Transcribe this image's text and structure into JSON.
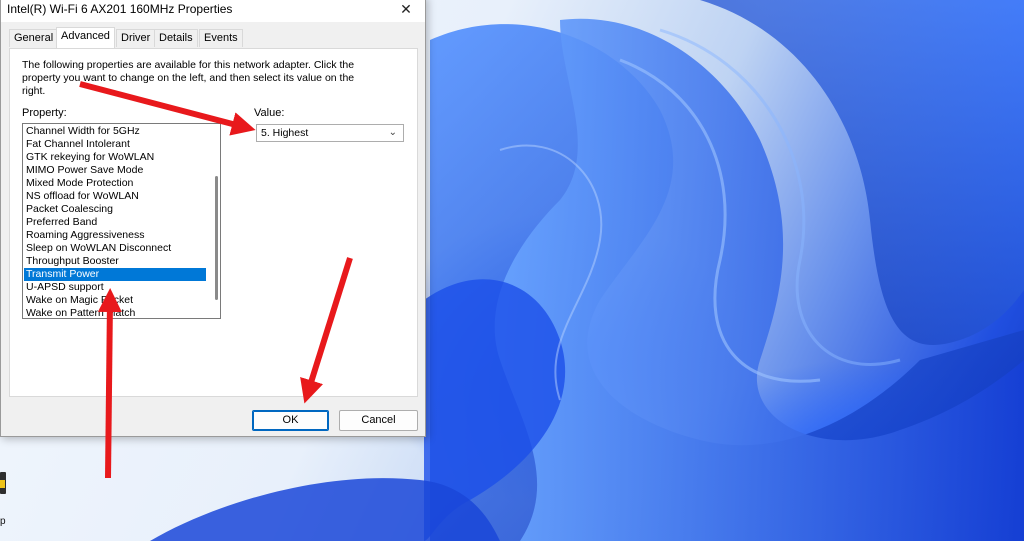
{
  "window": {
    "title": "Intel(R) Wi-Fi 6 AX201 160MHz Properties",
    "close_glyph": "✕"
  },
  "tabs": [
    {
      "label": "General"
    },
    {
      "label": "Advanced",
      "active": true
    },
    {
      "label": "Driver"
    },
    {
      "label": "Details"
    },
    {
      "label": "Events"
    }
  ],
  "advanced": {
    "description": "The following properties are available for this network adapter. Click the property you want to change on the left, and then select its value on the right.",
    "property_label": "Property:",
    "value_label": "Value:",
    "properties": [
      "Channel Width for 5GHz",
      "Fat Channel Intolerant",
      "GTK rekeying for WoWLAN",
      "MIMO Power Save Mode",
      "Mixed Mode Protection",
      "NS offload for WoWLAN",
      "Packet Coalescing",
      "Preferred Band",
      "Roaming Aggressiveness",
      "Sleep on WoWLAN Disconnect",
      "Throughput Booster",
      "Transmit Power",
      "U-APSD support",
      "Wake on Magic Packet",
      "Wake on Pattern Match"
    ],
    "selected_property": "Transmit Power",
    "selected_value": "5. Highest"
  },
  "buttons": {
    "ok": "OK",
    "cancel": "Cancel"
  },
  "desktop": {
    "icon_label_fragment": "p"
  },
  "colors": {
    "selection": "#0078d7",
    "annotation_arrow": "#e8191c",
    "ok_border": "#0067c0"
  },
  "icons": {
    "close": "close-icon",
    "dropdown": "chevron-down-icon"
  }
}
